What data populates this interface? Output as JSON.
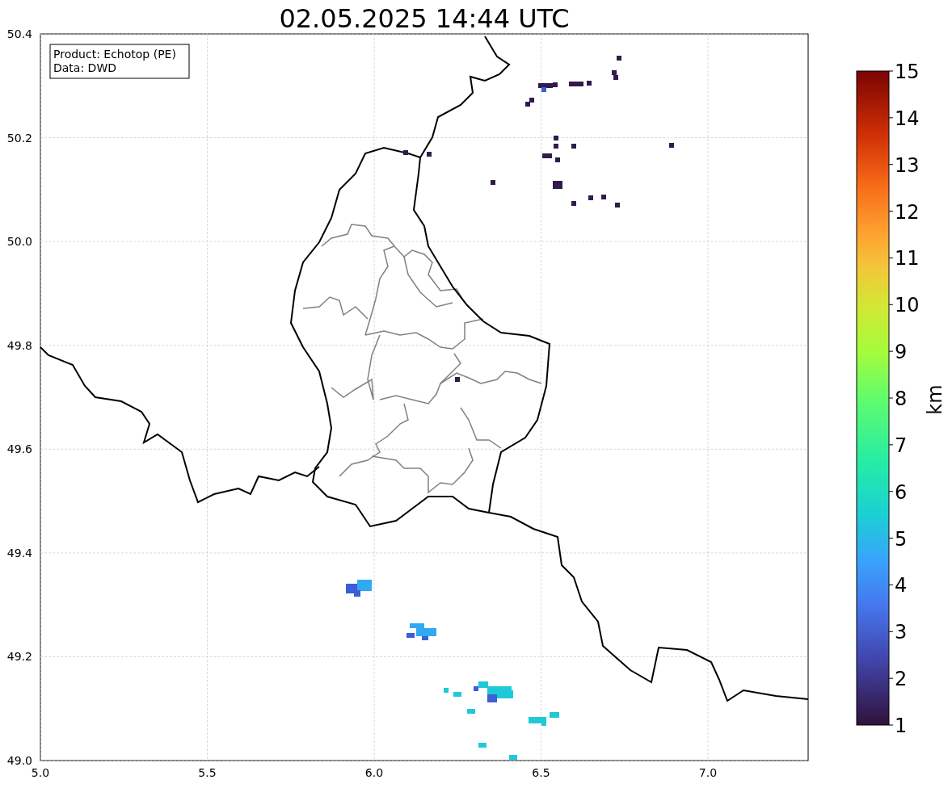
{
  "title": "02.05.2025 14:44 UTC",
  "map": {
    "legend": [
      "Product: Echotop (PE)",
      "Data: DWD"
    ],
    "xticks": [
      "5.0",
      "5.5",
      "6.0",
      "6.5",
      "7.0"
    ],
    "yticks": [
      "50.4",
      "50.2",
      "50.0",
      "49.8",
      "49.6",
      "49.4",
      "49.2",
      "49.0"
    ]
  },
  "colorbar": {
    "ticks": [
      "15",
      "14",
      "13",
      "12",
      "11",
      "10",
      "9",
      "8",
      "7",
      "6",
      "5",
      "4",
      "3",
      "2",
      "1"
    ],
    "label": "km"
  }
}
